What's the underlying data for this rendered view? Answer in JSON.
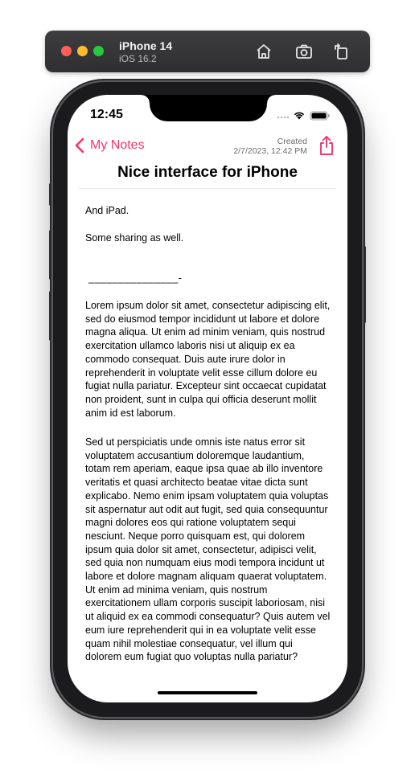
{
  "simulator": {
    "device_name": "iPhone 14",
    "os_version": "iOS 16.2",
    "buttons": [
      "home-icon",
      "screenshot-icon",
      "rotate-icon"
    ]
  },
  "status_bar": {
    "time": "12:45",
    "icons": [
      "cellular-dots-icon",
      "wifi-icon",
      "battery-icon"
    ]
  },
  "nav": {
    "back_label": "My Notes",
    "created_label": "Created",
    "created_date": "2/7/2023, 12:42 PM",
    "title": "Nice interface for iPhone",
    "accent_color": "#f0386b"
  },
  "note": {
    "line1": "And iPad.",
    "line2": "Some sharing as well.",
    "rule": "_______________-",
    "para1": "Lorem ipsum dolor sit amet, consectetur adipiscing elit, sed do eiusmod tempor incididunt ut labore et dolore magna aliqua. Ut enim ad minim veniam, quis nostrud exercitation ullamco laboris nisi ut aliquip ex ea commodo consequat. Duis aute irure dolor in reprehenderit in voluptate velit esse cillum dolore eu fugiat nulla pariatur. Excepteur sint occaecat cupidatat non proident, sunt in culpa qui officia deserunt mollit anim id est laborum.",
    "para2": "Sed ut perspiciatis unde omnis iste natus error sit voluptatem accusantium doloremque laudantium, totam rem aperiam, eaque ipsa quae ab illo inventore veritatis et quasi architecto beatae vitae dicta sunt explicabo. Nemo enim ipsam voluptatem quia voluptas sit aspernatur aut odit aut fugit, sed quia consequuntur magni dolores eos qui ratione voluptatem sequi nesciunt. Neque porro quisquam est, qui dolorem ipsum quia dolor sit amet, consectetur, adipisci velit, sed quia non numquam eius modi tempora incidunt ut labore et dolore magnam aliquam quaerat voluptatem. Ut enim ad minima veniam, quis nostrum exercitationem ullam corporis suscipit laboriosam, nisi ut aliquid ex ea commodi consequatur? Quis autem vel eum iure reprehenderit qui in ea voluptate velit esse quam nihil molestiae consequatur, vel illum qui dolorem eum fugiat quo voluptas nulla pariatur?"
  }
}
